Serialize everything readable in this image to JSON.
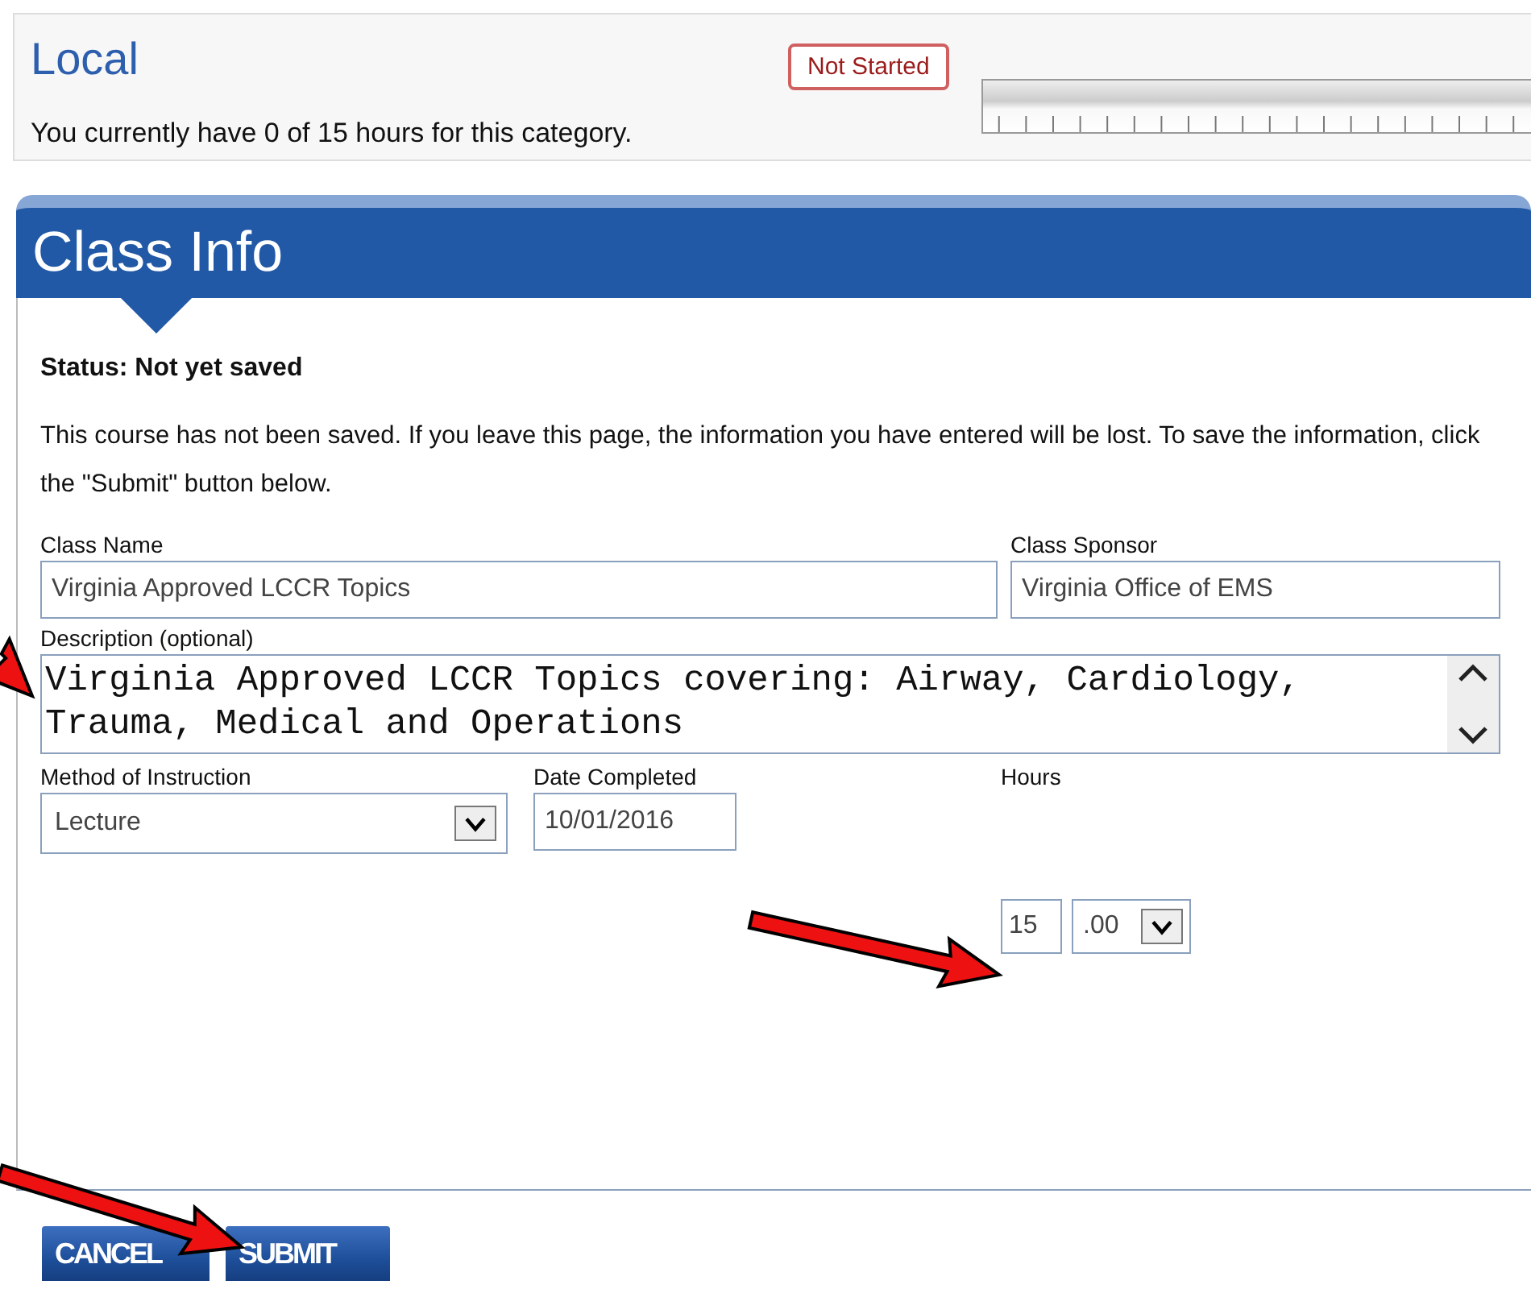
{
  "category": {
    "title": "Local",
    "status": "Not Started",
    "summary": "You currently have 0 of 15 hours for this category."
  },
  "panel": {
    "title": "Class Info",
    "status_label": "Status: Not yet saved",
    "notice": "This course has not been saved. If you leave this page, the information you have entered will be lost. To save the information, click the \"Submit\" button below."
  },
  "fields": {
    "class_name": {
      "label": "Class Name",
      "value": "Virginia Approved LCCR Topics"
    },
    "class_sponsor": {
      "label": "Class Sponsor",
      "value": "Virginia Office of EMS"
    },
    "description": {
      "label": "Description (optional)",
      "value": "Virginia Approved LCCR Topics covering: Airway, Cardiology, Trauma, Medical and Operations"
    },
    "method": {
      "label": "Method of Instruction",
      "value": "Lecture"
    },
    "date": {
      "label": "Date Completed",
      "value": "10/01/2016"
    },
    "hours": {
      "label": "Hours",
      "value": "15",
      "fraction": ".00"
    }
  },
  "buttons": [
    {
      "label": "CANCEL"
    },
    {
      "label": "SUBMIT"
    }
  ]
}
